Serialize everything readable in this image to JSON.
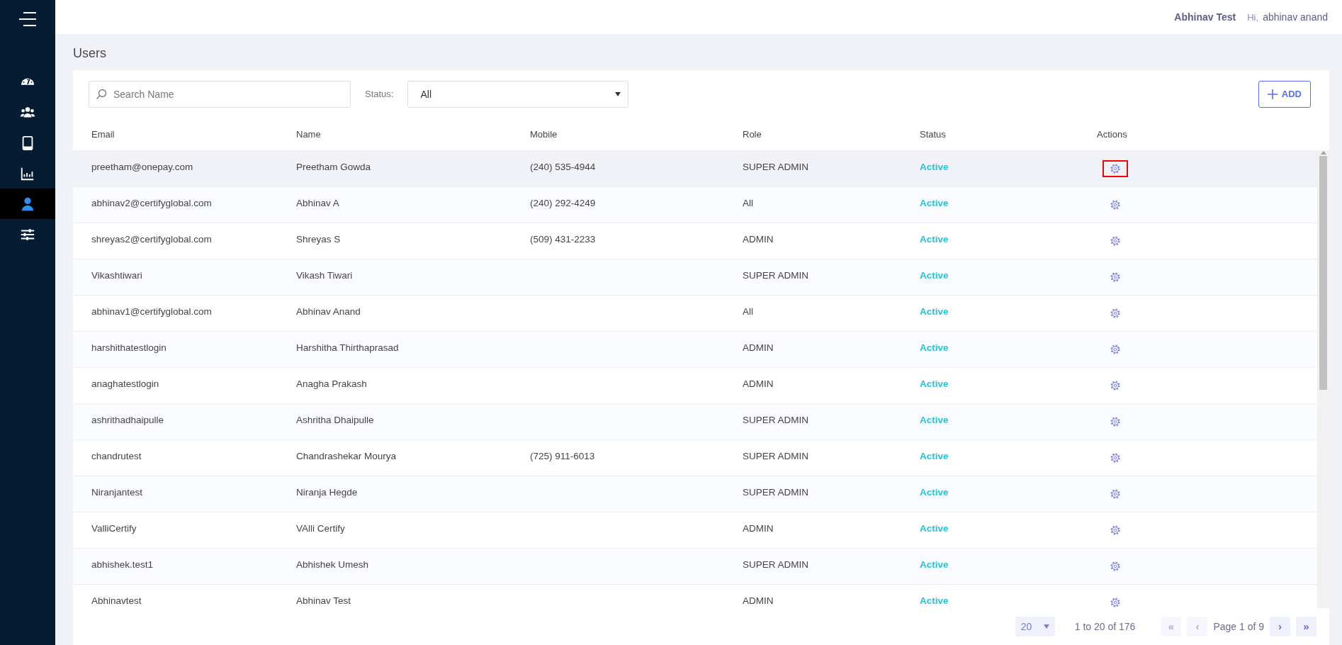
{
  "sidebar": {
    "items": [
      {
        "selected": false
      },
      {
        "selected": false
      },
      {
        "selected": false
      },
      {
        "selected": false
      },
      {
        "selected": true
      },
      {
        "selected": false
      }
    ]
  },
  "header": {
    "company": "Abhinav Test",
    "greeting": "Hi,",
    "user": "abhinav anand"
  },
  "page_title": "Users",
  "filters": {
    "search": {
      "placeholder": "Search Name"
    },
    "status_label": "Status:",
    "status_value": "All",
    "add_button": "ADD"
  },
  "table": {
    "columns": [
      "Email",
      "Name",
      "Mobile",
      "Role",
      "Status",
      "Actions"
    ],
    "rows": [
      {
        "email": "preetham@onepay.com",
        "name": "Preetham Gowda",
        "mobile": "(240) 535-4944",
        "role": "SUPER ADMIN",
        "status": "Active",
        "selected": true,
        "action_highlighted": true
      },
      {
        "email": "abhinav2@certifyglobal.com",
        "name": "Abhinav A",
        "mobile": "(240) 292-4249",
        "role": "All",
        "status": "Active",
        "selected": false,
        "action_highlighted": false
      },
      {
        "email": "shreyas2@certifyglobal.com",
        "name": "Shreyas S",
        "mobile": "(509) 431-2233",
        "role": "ADMIN",
        "status": "Active",
        "selected": false,
        "action_highlighted": false
      },
      {
        "email": "Vikashtiwari",
        "name": "Vikash Tiwari",
        "role": "SUPER ADMIN",
        "status": "Active",
        "selected": false,
        "action_highlighted": false
      },
      {
        "email": "abhinav1@certifyglobal.com",
        "name": "Abhinav Anand",
        "role": "All",
        "status": "Active",
        "selected": false,
        "action_highlighted": false
      },
      {
        "email": "harshithatestlogin",
        "name": "Harshitha Thirthaprasad",
        "role": "ADMIN",
        "status": "Active",
        "selected": false,
        "action_highlighted": false
      },
      {
        "email": "anaghatestlogin",
        "name": "Anagha Prakash",
        "role": "ADMIN",
        "status": "Active",
        "selected": false,
        "action_highlighted": false
      },
      {
        "email": "ashrithadhaipulle",
        "name": "Ashritha Dhaipulle",
        "role": "SUPER ADMIN",
        "status": "Active",
        "selected": false,
        "action_highlighted": false
      },
      {
        "email": "chandrutest",
        "name": "Chandrashekar Mourya",
        "mobile": "(725) 911-6013",
        "role": "SUPER ADMIN",
        "status": "Active",
        "selected": false,
        "action_highlighted": false
      },
      {
        "email": "Niranjantest",
        "name": "Niranja Hegde",
        "role": "SUPER ADMIN",
        "status": "Active",
        "selected": false,
        "action_highlighted": false
      },
      {
        "email": "ValliCertify",
        "name": "VAlli Certify",
        "role": "ADMIN",
        "status": "Active",
        "selected": false,
        "action_highlighted": false
      },
      {
        "email": "abhishek.test1",
        "name": "Abhishek Umesh",
        "role": "SUPER ADMIN",
        "status": "Active",
        "selected": false,
        "action_highlighted": false
      },
      {
        "email": "Abhinavtest",
        "name": "Abhinav Test",
        "role": "ADMIN",
        "status": "Active",
        "selected": false,
        "action_highlighted": false
      }
    ]
  },
  "pagination": {
    "page_size": "20",
    "range": "1 to 20 of 176",
    "page_label": "Page 1 of 9",
    "buttons": [
      {
        "label": "«",
        "disabled": true
      },
      {
        "label": "‹",
        "disabled": true
      },
      {
        "label": "›",
        "disabled": false
      },
      {
        "label": "»",
        "disabled": false
      }
    ]
  }
}
